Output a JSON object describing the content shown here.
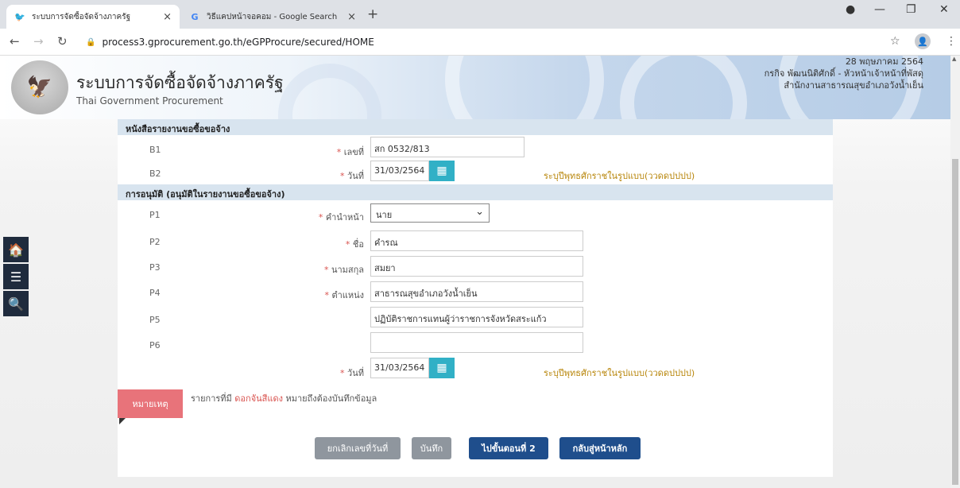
{
  "browser": {
    "tabs": [
      {
        "title": "ระบบการจัดซื้อจัดจ้างภาครัฐ",
        "favicon": "bird-icon",
        "close": "×"
      },
      {
        "title": "วิธีแคปหน้าจอคอม - Google Search",
        "favicon": "google-icon",
        "favicon_text": "G",
        "close": "×"
      }
    ],
    "new_tab": "+",
    "url": "process3.gprocurement.go.th/eGPProcure/secured/HOME"
  },
  "header": {
    "title": "ระบบการจัดซื้อจัดจ้างภาครัฐ",
    "subtitle": "Thai Government Procurement",
    "date": "28 พฤษภาคม 2564",
    "user": "กรกิจ พัฒนนิติศักดิ์ - หัวหน้าเจ้าหน้าที่พัสดุ",
    "agency": "สำนักงานสาธารณสุขอำเภอวังน้ำเย็น"
  },
  "sections": {
    "report": "หนังสือรายงานขอซื้อขอจ้าง",
    "approval": "การอนุมัติ (อนุมัติในรายงานขอซื้อขอจ้าง)"
  },
  "rows": {
    "b1": {
      "code": "B1",
      "label": "เลขที่",
      "value": "สก 0532/813"
    },
    "b2": {
      "code": "B2",
      "label": "วันที่",
      "value": "31/03/2564",
      "hint": "ระบุปีพุทธศักราชในรูปแบบ(ววดดปปปป)"
    },
    "p1": {
      "code": "P1",
      "label": "คำนำหน้า",
      "value": "นาย"
    },
    "p2": {
      "code": "P2",
      "label": "ชื่อ",
      "value": "คำรณ"
    },
    "p3": {
      "code": "P3",
      "label": "นามสกุล",
      "value": "สมยา"
    },
    "p4": {
      "code": "P4",
      "label": "ตำแหน่ง",
      "value": "สาธารณสุขอำเภอวังน้ำเย็น"
    },
    "p5": {
      "code": "P5",
      "label": "",
      "value": "ปฏิบัติราชการแทนผู้ว่าราชการจังหวัดสระแก้ว"
    },
    "p6": {
      "code": "P6",
      "label": "",
      "value": ""
    },
    "date2": {
      "label": "วันที่",
      "value": "31/03/2564",
      "hint": "ระบุปีพุทธศักราชในรูปแบบ(ววดดปปปป)"
    }
  },
  "required_mark": "*",
  "note": {
    "label": "หมายเหตุ",
    "text_before": "รายการที่มี",
    "text_red": "ดอกจันสีแดง",
    "text_after": "หมายถึงต้องบันทึกข้อมูล"
  },
  "buttons": {
    "cancel_date": "ยกเลิกเลขที่วันที่",
    "save": "บันทึก",
    "next_step": "ไปขั้นตอนที่ 2",
    "back_home": "กลับสู่หน้าหลัก"
  },
  "colors": {
    "section_header": "#d8e4ef",
    "calendar_button": "#31b0c6",
    "primary_button": "#1f4e8c",
    "grey_button": "#8f969e",
    "note_box": "#e8737a",
    "required": "#d9534f",
    "sidebar": "#1f2b3d"
  },
  "icons": {
    "home": "home-icon",
    "menu": "menu-icon",
    "search": "search-icon",
    "calendar": "calendar-icon"
  }
}
